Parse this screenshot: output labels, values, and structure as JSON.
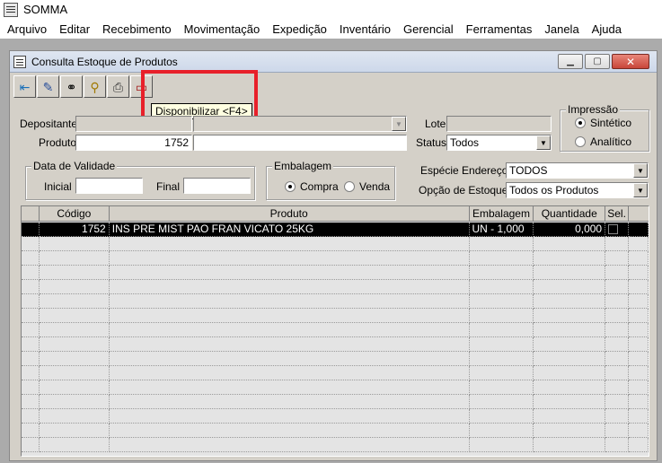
{
  "app": {
    "title": "SOMMA"
  },
  "menu": [
    "Arquivo",
    "Editar",
    "Recebimento",
    "Movimentação",
    "Expedição",
    "Inventário",
    "Gerencial",
    "Ferramentas",
    "Janela",
    "Ajuda"
  ],
  "window": {
    "title": "Consulta Estoque de Produtos"
  },
  "toolbar": {
    "tooltip": "Disponibilizar <F4>",
    "buttons": [
      {
        "name": "exit-icon",
        "glyph": "⇤",
        "color": "#1a6fb8"
      },
      {
        "name": "eraser-icon",
        "glyph": "✎",
        "color": "#2a4f9a"
      },
      {
        "name": "binoculars-icon",
        "glyph": "⚭",
        "color": "#000000"
      },
      {
        "name": "search-document-icon",
        "glyph": "⚲",
        "color": "#a07800"
      },
      {
        "name": "printer-icon",
        "glyph": "⎙",
        "color": "#333333"
      },
      {
        "name": "disponibilizar-icon",
        "glyph": "▭",
        "color": "#a01010"
      }
    ]
  },
  "form": {
    "depositante_label": "Depositante",
    "produto_label": "Produto",
    "produto_code": "1752",
    "lote_label": "Lote",
    "status_label": "Status",
    "status_value": "Todos",
    "impressao_title": "Impressão",
    "impressao_opt1": "Sintético",
    "impressao_opt2": "Analítico",
    "validade_title": "Data de Validade",
    "inicial_label": "Inicial",
    "final_label": "Final",
    "embalagem_title": "Embalagem",
    "embalagem_opt1": "Compra",
    "embalagem_opt2": "Venda",
    "especie_label": "Espécie Endereço",
    "especie_value": "TODOS",
    "opcao_label": "Opção de Estoque",
    "opcao_value": "Todos os Produtos"
  },
  "grid": {
    "headers": [
      "Código",
      "Produto",
      "Embalagem",
      "Quantidade",
      "Sel."
    ],
    "rows": [
      {
        "codigo": "1752",
        "produto": "INS PRE MIST PAO FRAN VICATO 25KG",
        "embalagem": "UN - 1,000",
        "quantidade": "0,000"
      }
    ]
  }
}
